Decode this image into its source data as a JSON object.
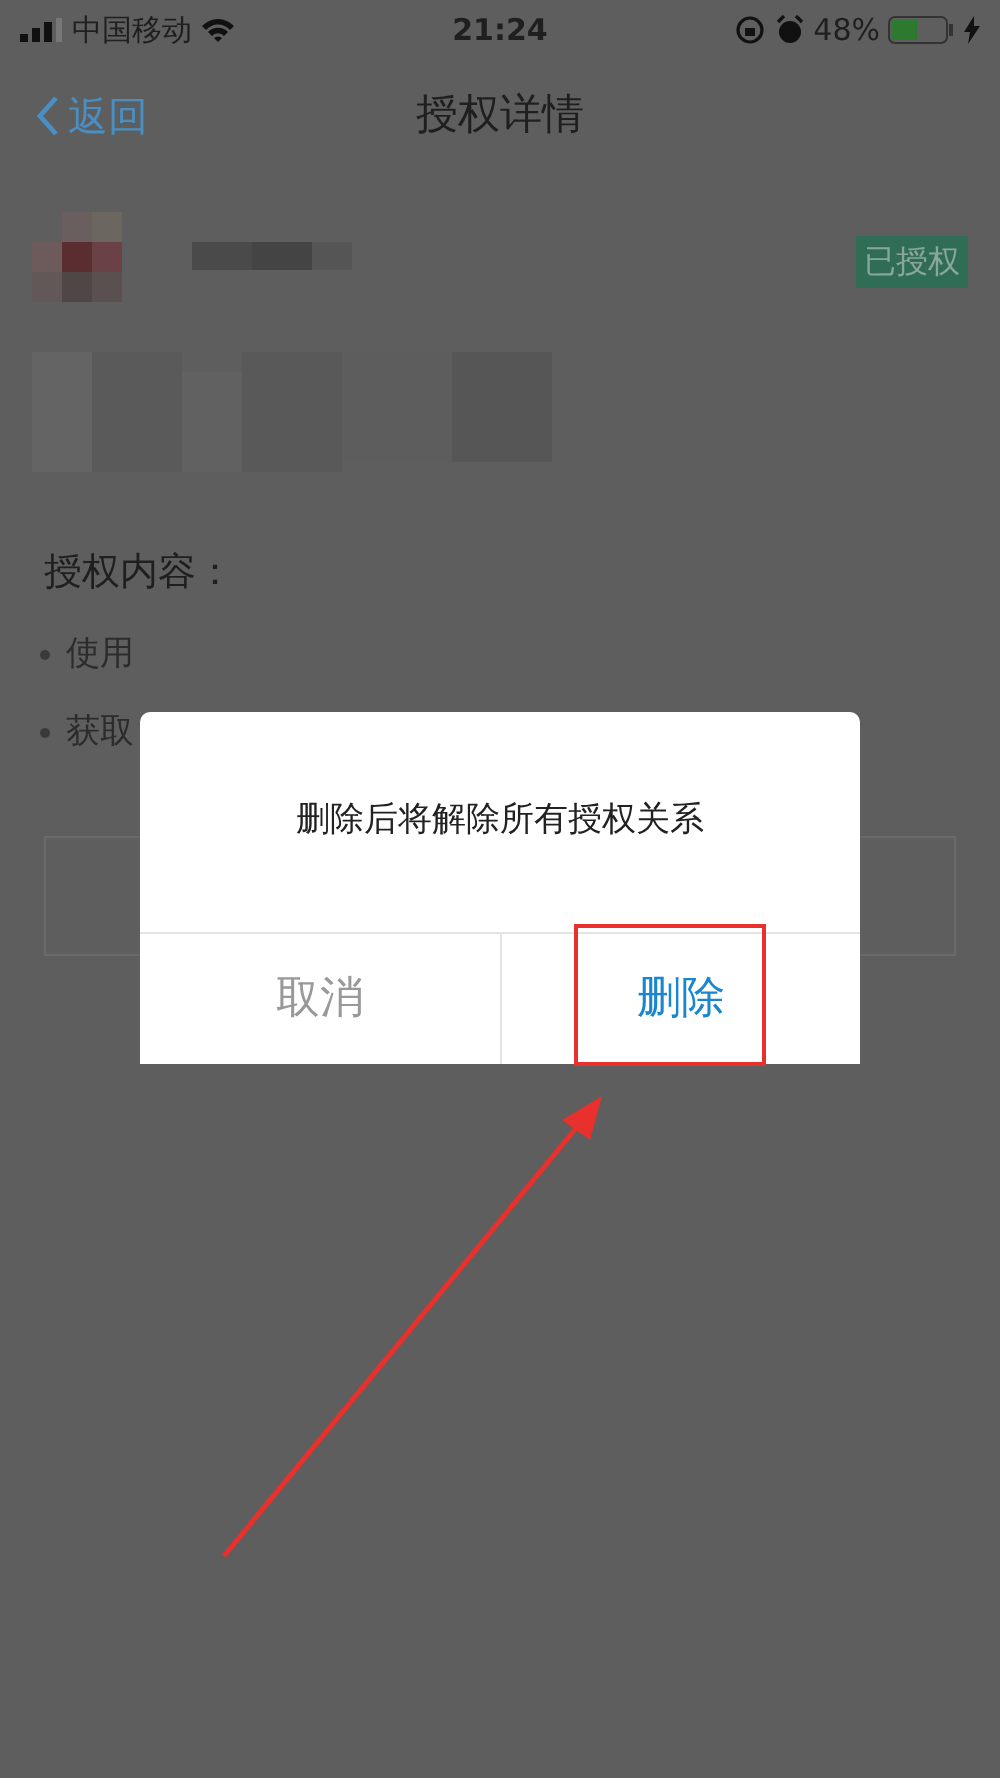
{
  "status_bar": {
    "carrier": "中国移动",
    "time": "21:24",
    "battery_text": "48%",
    "battery": {
      "level": 0.48,
      "charging": true
    }
  },
  "nav": {
    "back": "返回",
    "title": "授权详情"
  },
  "app": {
    "tag": "已授权"
  },
  "section": {
    "title": "授权内容："
  },
  "permissions": [
    "使用",
    "获取"
  ],
  "dialog": {
    "message": "删除后将解除所有授权关系",
    "buttons": [
      {
        "label": "取消",
        "kind": "cancel",
        "highlighted": false
      },
      {
        "label": "删除",
        "kind": "confirm",
        "highlighted": true
      }
    ]
  },
  "annotation": {
    "arrow": true
  }
}
